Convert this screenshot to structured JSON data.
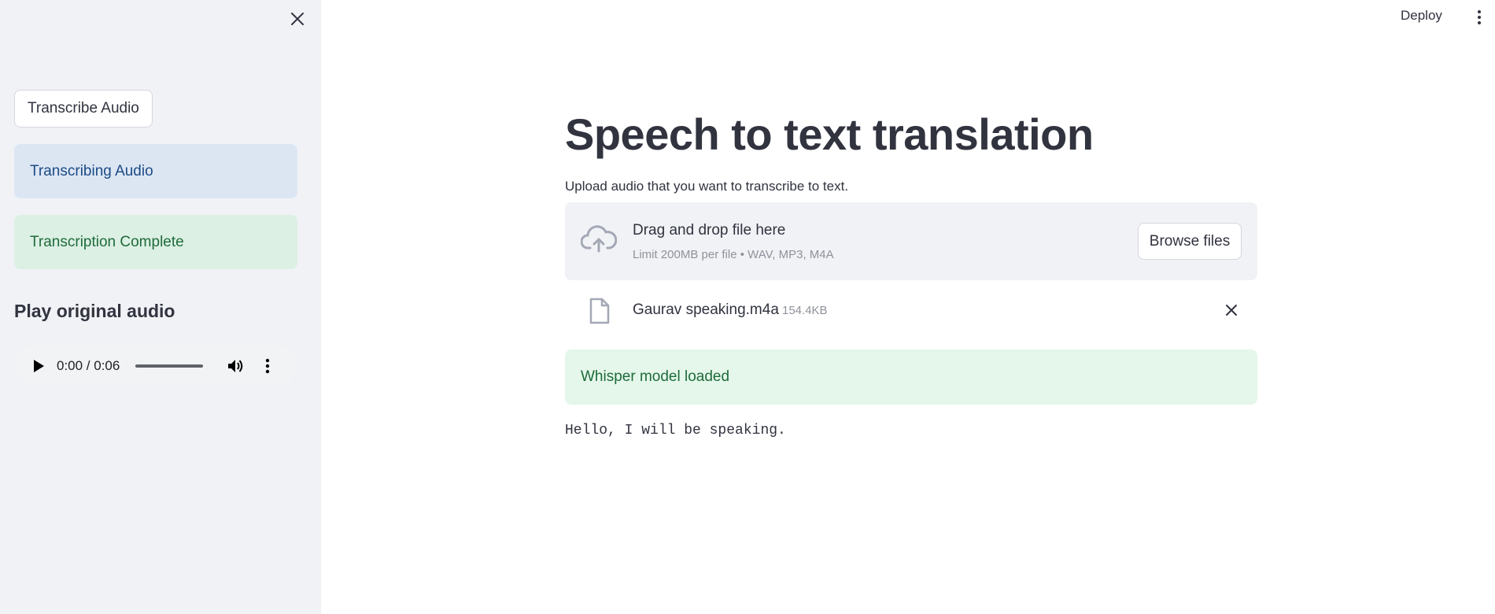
{
  "header": {
    "deploy_label": "Deploy",
    "menu_icon": "more-vertical-icon"
  },
  "sidebar": {
    "close_icon": "close-icon",
    "transcribe_button": "Transcribe Audio",
    "info_alert": "Transcribing Audio",
    "success_alert": "Transcription Complete",
    "audio_heading": "Play original audio",
    "audio": {
      "current_time": "0:00",
      "duration": "0:06",
      "time_display": "0:00 / 0:06",
      "progress": 0.0
    }
  },
  "main": {
    "title": "Speech to text translation",
    "uploader": {
      "label": "Upload audio that you want to transcribe to text.",
      "drop_title": "Drag and drop file here",
      "drop_subtitle": "Limit 200MB per file • WAV, MP3, M4A",
      "browse_button": "Browse files"
    },
    "file": {
      "name": "Gaurav speaking.m4a",
      "size": "154.4KB"
    },
    "status_alert": "Whisper model loaded",
    "transcription": "Hello, I will be speaking."
  },
  "colors": {
    "sidebar_bg": "#f0f2f6",
    "info_bg": "#dce6f3",
    "success_bg": "#dcf0e4",
    "text": "#31333f"
  }
}
